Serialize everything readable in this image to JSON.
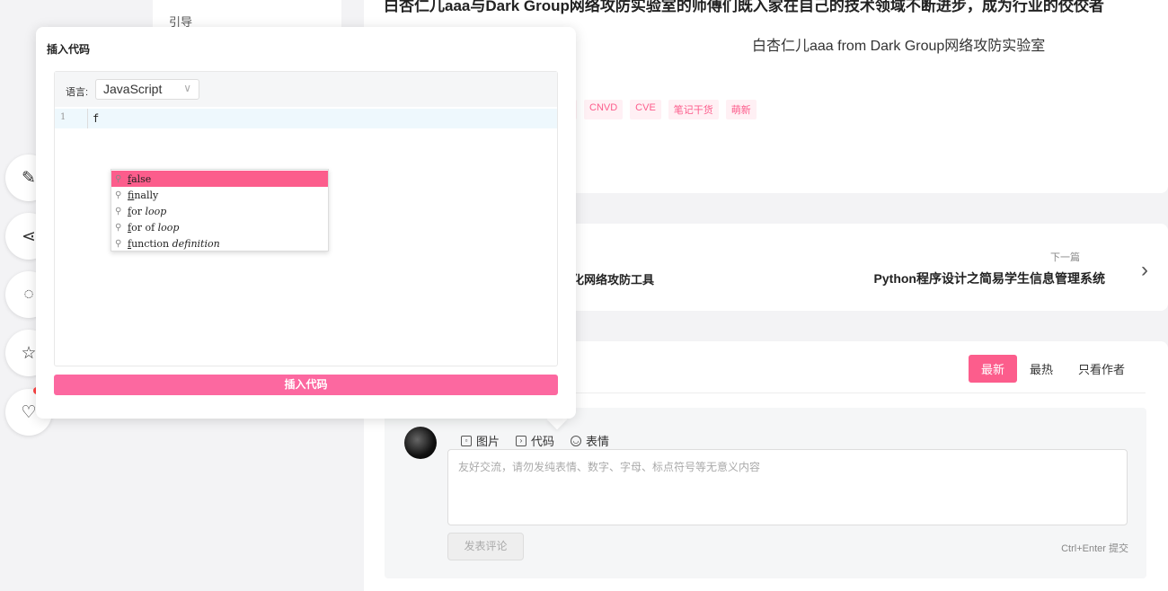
{
  "sidebar": {
    "partial_text": "引导"
  },
  "article": {
    "title": "白杏仁儿aaa与Dark Group网络攻防实验室的师傅们既入家在自己的技术领域不断进步，成为行业的佼佼者",
    "signature": "白杏仁儿aaa from Dark Group网络攻防实验室",
    "tags": [
      "",
      "CNVD",
      "CVE",
      "笔记干货",
      "萌新"
    ]
  },
  "navigation": {
    "prev_title": "化网络攻防工具",
    "next_label": "下一篇",
    "next_title": "Python程序设计之简易学生信息管理系统",
    "next_arrow": "›"
  },
  "comments": {
    "sort_tabs": [
      "最新",
      "最热",
      "只看作者"
    ],
    "active_sort": "最新",
    "toolbar": [
      {
        "label": "图片",
        "icon": "image-icon"
      },
      {
        "label": "代码",
        "icon": "code-icon"
      },
      {
        "label": "表情",
        "icon": "emoji-icon"
      }
    ],
    "placeholder": "友好交流，请勿发纯表情、数字、字母、标点符号等无意义内容",
    "submit_label": "发表评论",
    "shortcut": "Ctrl+Enter 提交"
  },
  "fabs": [
    {
      "icon": "edit-icon",
      "glyph": "✎"
    },
    {
      "icon": "share-icon",
      "glyph": "⋖"
    },
    {
      "icon": "comment-icon",
      "glyph": "◌"
    },
    {
      "icon": "star-icon",
      "glyph": "☆"
    },
    {
      "icon": "heart-icon",
      "glyph": "♡"
    }
  ],
  "modal": {
    "title": "插入代码",
    "lang_label": "语言:",
    "lang_value": "JavaScript",
    "line_number": "1",
    "code": "f",
    "suggestions": [
      {
        "prefix": "f",
        "rest": "alse",
        "suffix": ""
      },
      {
        "prefix": "f",
        "rest": "inally",
        "suffix": ""
      },
      {
        "prefix": "f",
        "rest": "or ",
        "suffix": "loop"
      },
      {
        "prefix": "f",
        "rest": "or of ",
        "suffix": "loop"
      },
      {
        "prefix": "f",
        "rest": "unction ",
        "suffix": "definition"
      }
    ],
    "insert_label": "插入代码"
  },
  "colors": {
    "accent": "#fc5d8c",
    "insert_button": "#fc68a0"
  }
}
